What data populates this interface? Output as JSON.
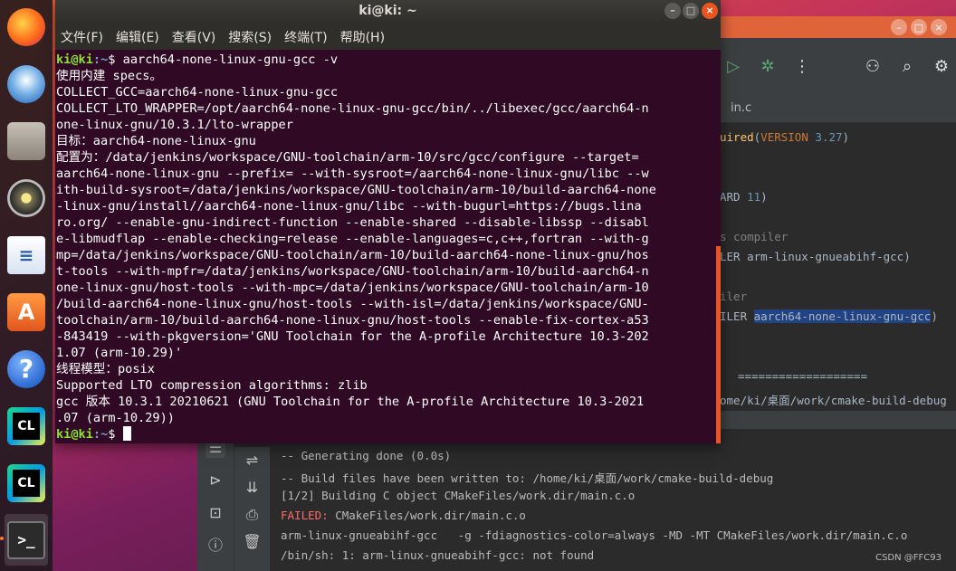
{
  "terminal": {
    "title": "ki@ki: ~",
    "window_buttons": {
      "minimize": "–",
      "maximize": "□",
      "close": "×"
    },
    "menu": [
      "文件(F)",
      "编辑(E)",
      "查看(V)",
      "搜索(S)",
      "终端(T)",
      "帮助(H)"
    ],
    "prompt_user": "ki@ki",
    "prompt_path": ":~",
    "prompt_symbol": "$ ",
    "command": "aarch64-none-linux-gnu-gcc -v",
    "output_lines": [
      "使用内建 specs。",
      "COLLECT_GCC=aarch64-none-linux-gnu-gcc",
      "COLLECT_LTO_WRAPPER=/opt/aarch64-none-linux-gnu-gcc/bin/../libexec/gcc/aarch64-n",
      "one-linux-gnu/10.3.1/lto-wrapper",
      "目标：aarch64-none-linux-gnu",
      "配置为：/data/jenkins/workspace/GNU-toolchain/arm-10/src/gcc/configure --target=",
      "aarch64-none-linux-gnu --prefix= --with-sysroot=/aarch64-none-linux-gnu/libc --w",
      "ith-build-sysroot=/data/jenkins/workspace/GNU-toolchain/arm-10/build-aarch64-none",
      "-linux-gnu/install//aarch64-none-linux-gnu/libc --with-bugurl=https://bugs.lina",
      "ro.org/ --enable-gnu-indirect-function --enable-shared --disable-libssp --disabl",
      "e-libmudflap --enable-checking=release --enable-languages=c,c++,fortran --with-g",
      "mp=/data/jenkins/workspace/GNU-toolchain/arm-10/build-aarch64-none-linux-gnu/hos",
      "t-tools --with-mpfr=/data/jenkins/workspace/GNU-toolchain/arm-10/build-aarch64-n",
      "one-linux-gnu/host-tools --with-mpc=/data/jenkins/workspace/GNU-toolchain/arm-10",
      "/build-aarch64-none-linux-gnu/host-tools --with-isl=/data/jenkins/workspace/GNU-",
      "toolchain/arm-10/build-aarch64-none-linux-gnu/host-tools --enable-fix-cortex-a53",
      "-843419 --with-pkgversion='GNU Toolchain for the A-profile Architecture 10.3-202",
      "1.07 (arm-10.29)'",
      "线程模型：posix",
      "Supported LTO compression algorithms: zlib",
      "gcc 版本 10.3.1 20210621 (GNU Toolchain for the A-profile Architecture 10.3-2021",
      ".07 (arm-10.29))"
    ]
  },
  "ide": {
    "file_tab": "in.c",
    "code": {
      "line1_fn": "uired",
      "line1_arg_kw": "VERSION",
      "line1_num": "3.27",
      "line2_a": "ARD ",
      "line2_num": "11",
      "line3_comment": "s compiler",
      "line4_a": "LER arm-linux-gnueabihf-gcc)",
      "line5_comment": "iler",
      "line6_a": "ILER ",
      "line6_hl": "aarch64-none-linux-gnu-gcc",
      "line6_b": ")"
    },
    "separator": "===================",
    "path": "ome/ki/桌面/work/cmake-build-debug",
    "console": {
      "line1": "-- Generating done (0.0s)",
      "line2": "-- Build files have been written to: /home/ki/桌面/work/cmake-build-debug",
      "line3": "[1/2] Building C object CMakeFiles/work.dir/main.c.o",
      "line4_prefix": "FAILED: ",
      "line4_rest": "CMakeFiles/work.dir/main.c.o",
      "line5": "arm-linux-gnueabihf-gcc   -g -fdiagnostics-color=always -MD -MT CMakeFiles/work.dir/main.c.o",
      "line6": "/bin/sh: 1: arm-linux-gnueabihf-gcc: not found"
    },
    "watermark": "CSDN @FFC93"
  },
  "dock": {
    "items": [
      {
        "name": "firefox-icon",
        "glyph": ""
      },
      {
        "name": "thunderbird-icon",
        "glyph": ""
      },
      {
        "name": "files-icon",
        "glyph": ""
      },
      {
        "name": "rhythmbox-icon",
        "glyph": ""
      },
      {
        "name": "libreoffice-writer-icon",
        "glyph": "≡"
      },
      {
        "name": "software-store-icon",
        "glyph": "A"
      },
      {
        "name": "help-icon",
        "glyph": "?"
      },
      {
        "name": "clion-icon",
        "glyph": "CL"
      },
      {
        "name": "clion-icon-2",
        "glyph": "CL"
      },
      {
        "name": "terminal-icon",
        "glyph": ">_"
      }
    ]
  },
  "colors": {
    "terminal_bg": "#300a24",
    "prompt_user": "#8ae234",
    "prompt_path": "#729fcf",
    "accent": "#e95420",
    "ide_bg": "#2b2b2b",
    "error": "#ff6b68"
  }
}
